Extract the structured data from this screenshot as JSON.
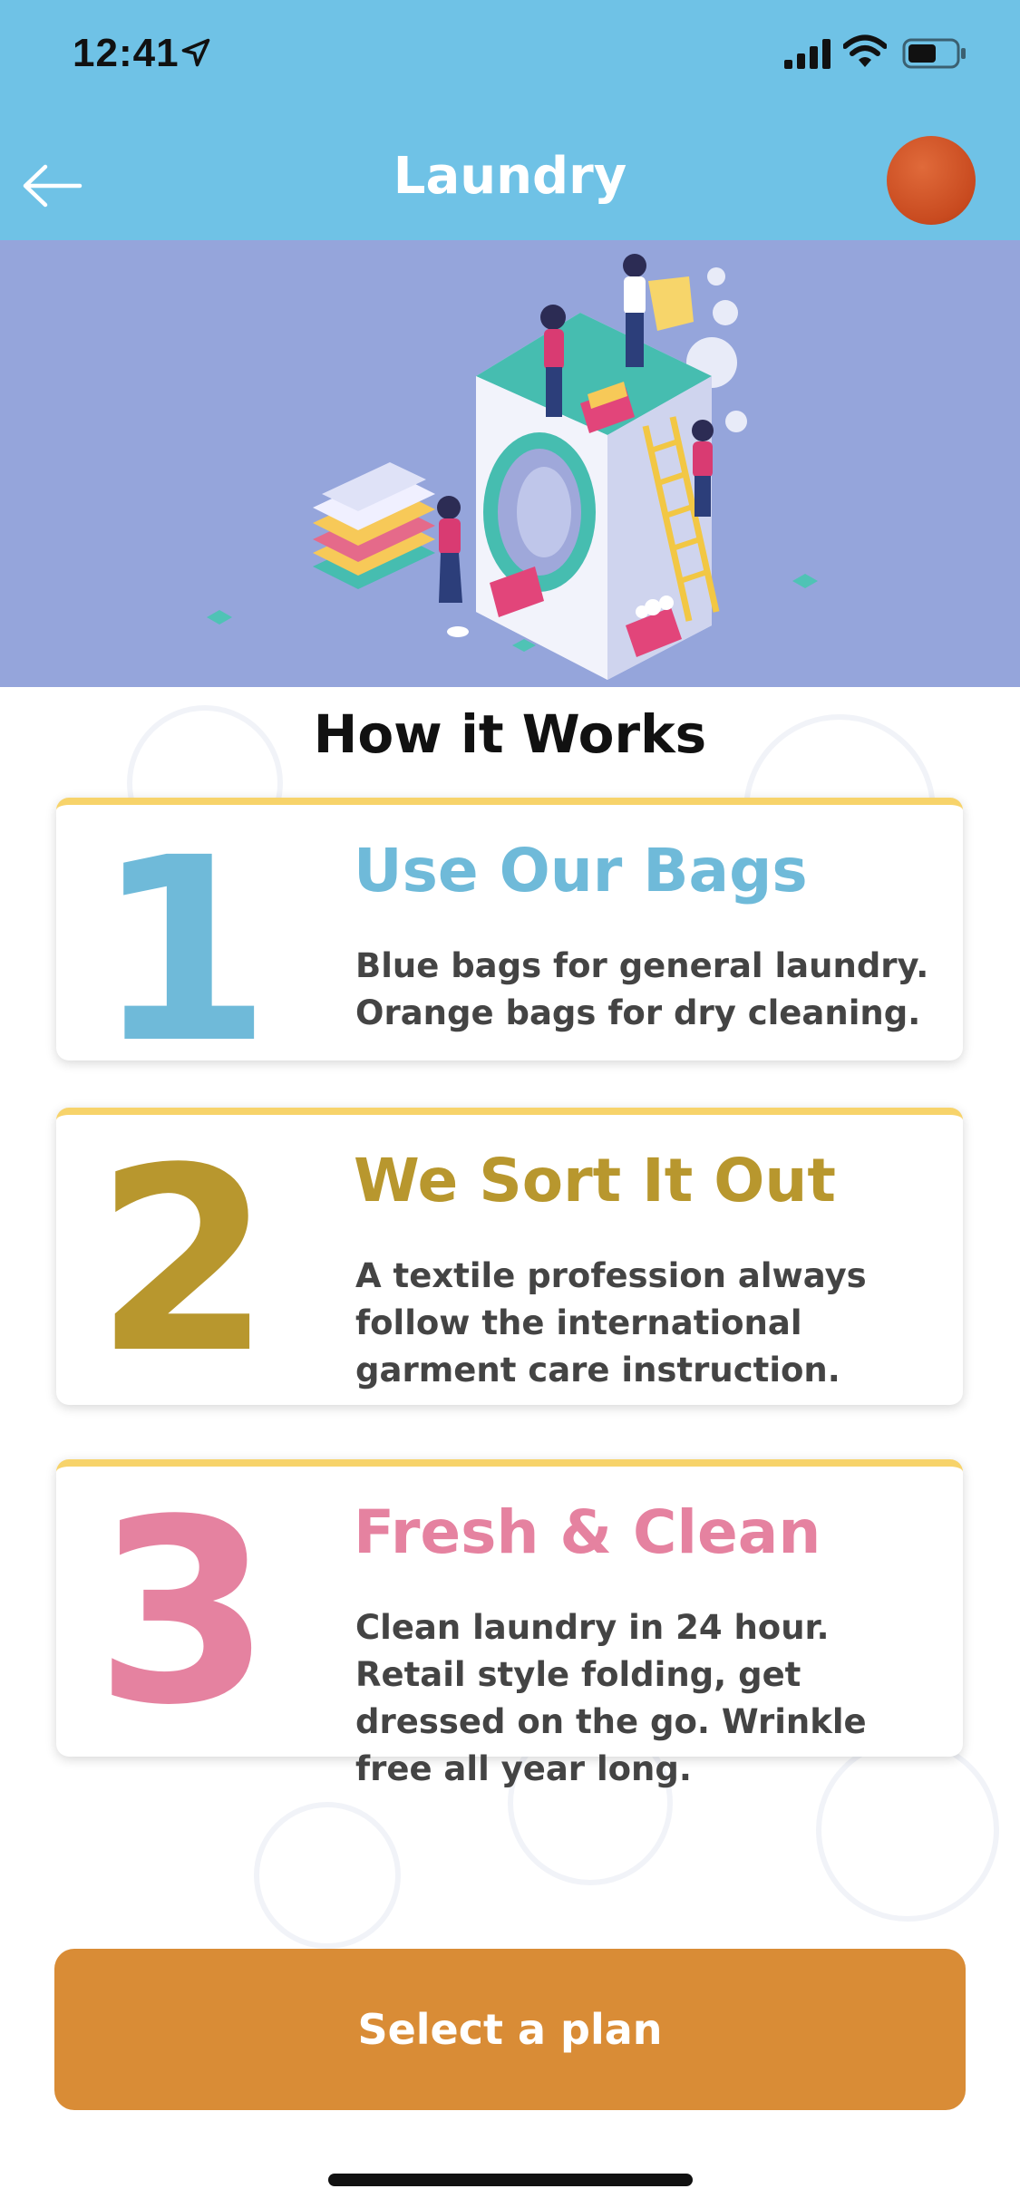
{
  "status_bar": {
    "time": "12:41",
    "icons": [
      "location-arrow-icon",
      "signal-icon",
      "wifi-icon",
      "battery-icon"
    ]
  },
  "nav": {
    "title": "Laundry",
    "back_icon": "arrow-left-icon",
    "avatar_color": "#c84a1f"
  },
  "colors": {
    "header": "#6fc2e6",
    "hero_bg": "#95a5db",
    "accent_border": "#f7d36a",
    "cta": "#d98c36"
  },
  "section_title": "How it Works",
  "steps": [
    {
      "number": "1",
      "title": "Use Our Bags",
      "description": "Blue bags for general laundry. Orange bags for dry cleaning.",
      "color": "#6fbad9"
    },
    {
      "number": "2",
      "title": "We Sort It Out",
      "description": "A textile profession always follow the international garment care instruction.",
      "color": "#b8972e"
    },
    {
      "number": "3",
      "title": "Fresh & Clean",
      "description": "Clean laundry in 24 hour. Retail style folding, get dressed on the go. Wrinkle free all year long.",
      "color": "#e582a0"
    }
  ],
  "cta": {
    "label": "Select a plan"
  }
}
